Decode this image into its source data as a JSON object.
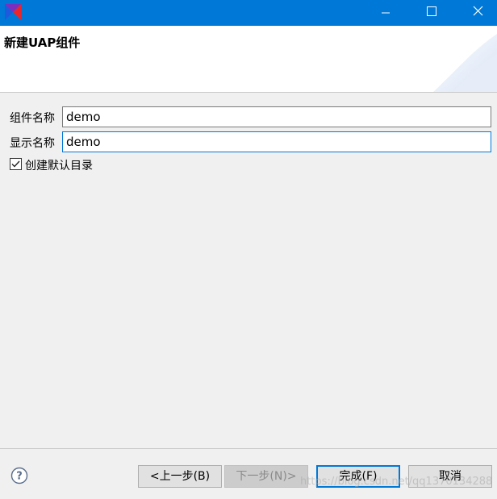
{
  "header": {
    "title": "新建UAP组件"
  },
  "form": {
    "component_name_label": "组件名称",
    "component_name_value": "demo",
    "display_name_label": "显示名称",
    "display_name_value": "demo"
  },
  "checkbox": {
    "label": "创建默认目录",
    "checked": true
  },
  "buttons": {
    "back": "<上一步(B)",
    "next": "下一步(N)>",
    "finish": "完成(F)",
    "cancel": "取消"
  },
  "watermark": {
    "text": "https://blog.csdn.net/qq1370134288"
  },
  "colors": {
    "titlebar": "#0078d7",
    "focus": "#0078d7",
    "dialog_bg": "#f0f0f0"
  },
  "icons": {
    "app": "app-logo-icon",
    "minimize": "minimize-icon",
    "maximize": "maximize-icon",
    "close": "close-icon",
    "help": "help-icon",
    "check": "checkmark-icon"
  }
}
